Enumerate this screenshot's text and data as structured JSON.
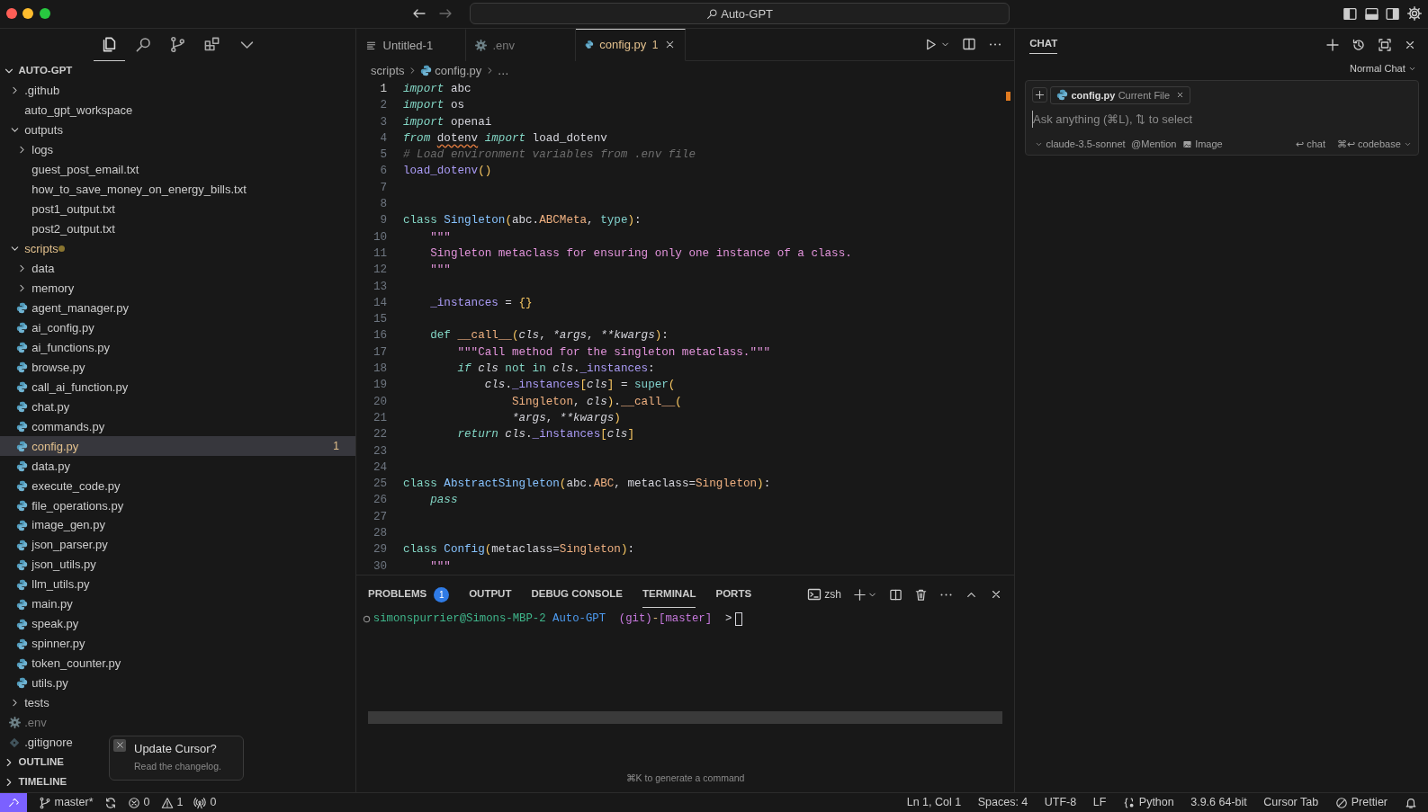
{
  "window": {
    "title": "Auto-GPT"
  },
  "activity_bar": [
    {
      "kind": "files",
      "selected": true
    },
    {
      "kind": "search",
      "selected": false
    },
    {
      "kind": "source-control",
      "selected": false
    },
    {
      "kind": "extensions",
      "selected": false
    },
    {
      "kind": "more",
      "selected": false
    }
  ],
  "explorer": {
    "title": "AUTO-GPT",
    "expanded": true,
    "items": [
      {
        "label": ".github",
        "kind": "folder",
        "expanded": false
      },
      {
        "label": "auto_gpt_workspace",
        "kind": "empty-folder"
      },
      {
        "label": "outputs",
        "kind": "folder",
        "expanded": true,
        "children": [
          {
            "label": "logs",
            "kind": "folder",
            "expanded": false
          },
          {
            "label": "guest_post_email.txt",
            "kind": "text-file"
          },
          {
            "label": "how_to_save_money_on_energy_bills.txt",
            "kind": "text-file"
          },
          {
            "label": "post1_output.txt",
            "kind": "text-file"
          },
          {
            "label": "post2_output.txt",
            "kind": "text-file"
          }
        ]
      },
      {
        "label": "scripts",
        "kind": "folder",
        "expanded": true,
        "modified": true,
        "children": [
          {
            "label": "data",
            "kind": "folder",
            "expanded": false
          },
          {
            "label": "memory",
            "kind": "folder",
            "expanded": false
          },
          {
            "label": "agent_manager.py",
            "kind": "python-file"
          },
          {
            "label": "ai_config.py",
            "kind": "python-file"
          },
          {
            "label": "ai_functions.py",
            "kind": "python-file"
          },
          {
            "label": "browse.py",
            "kind": "python-file"
          },
          {
            "label": "call_ai_function.py",
            "kind": "python-file"
          },
          {
            "label": "chat.py",
            "kind": "python-file"
          },
          {
            "label": "commands.py",
            "kind": "python-file"
          },
          {
            "label": "config.py",
            "kind": "python-file",
            "selected": true,
            "modified": true,
            "badge": "1"
          },
          {
            "label": "data.py",
            "kind": "python-file"
          },
          {
            "label": "execute_code.py",
            "kind": "python-file"
          },
          {
            "label": "file_operations.py",
            "kind": "python-file"
          },
          {
            "label": "image_gen.py",
            "kind": "python-file"
          },
          {
            "label": "json_parser.py",
            "kind": "python-file"
          },
          {
            "label": "json_utils.py",
            "kind": "python-file"
          },
          {
            "label": "llm_utils.py",
            "kind": "python-file"
          },
          {
            "label": "main.py",
            "kind": "python-file"
          },
          {
            "label": "speak.py",
            "kind": "python-file"
          },
          {
            "label": "spinner.py",
            "kind": "python-file"
          },
          {
            "label": "token_counter.py",
            "kind": "python-file"
          },
          {
            "label": "utils.py",
            "kind": "python-file"
          }
        ]
      },
      {
        "label": "tests",
        "kind": "folder",
        "expanded": false
      },
      {
        "label": ".env",
        "kind": "settings-file",
        "dimmed": true
      },
      {
        "label": ".gitignore",
        "kind": "git-file"
      }
    ]
  },
  "sections": [
    {
      "label": "OUTLINE",
      "expanded": false
    },
    {
      "label": "TIMELINE",
      "expanded": false
    }
  ],
  "toast": {
    "title": "Update Cursor?",
    "message": "Read the changelog."
  },
  "editor": {
    "tabs": [
      {
        "label": "Untitled-1",
        "kind": "untitled",
        "selected": false
      },
      {
        "label": ".env",
        "kind": "settings-file",
        "selected": false,
        "dimmed": true
      },
      {
        "label": "config.py",
        "kind": "python-file",
        "selected": true,
        "modified": true,
        "badge": "1"
      }
    ],
    "breadcrumb": [
      {
        "label": "scripts",
        "kind": "folder"
      },
      {
        "label": "config.py",
        "kind": "python-file"
      },
      {
        "label": "…",
        "kind": "symbol"
      }
    ],
    "lines": [
      {
        "n": "1",
        "current": true,
        "tokens": [
          {
            "t": "import",
            "kind": "kwi"
          },
          {
            "t": " abc",
            "kind": "p"
          }
        ]
      },
      {
        "n": "2",
        "tokens": [
          {
            "t": "import",
            "kind": "kwi"
          },
          {
            "t": " os",
            "kind": "p"
          }
        ]
      },
      {
        "n": "3",
        "tokens": [
          {
            "t": "import",
            "kind": "kwi"
          },
          {
            "t": " openai",
            "kind": "p"
          }
        ]
      },
      {
        "n": "4",
        "tokens": [
          {
            "t": "from ",
            "kind": "kwi"
          },
          {
            "t": "dotenv",
            "kind": "p",
            "squiggle": true
          },
          {
            "t": " import",
            "kind": "kwi"
          },
          {
            "t": " load_dotenv",
            "kind": "p"
          }
        ]
      },
      {
        "n": "5",
        "tokens": [
          {
            "t": "# Load environment variables from .env file",
            "kind": "com"
          }
        ]
      },
      {
        "n": "6",
        "tokens": [
          {
            "t": "load_dotenv",
            "kind": "fn"
          },
          {
            "t": "()",
            "kind": "punc"
          }
        ]
      },
      {
        "n": "7"
      },
      {
        "n": "8"
      },
      {
        "n": "9",
        "tokens": [
          {
            "t": "class",
            "kind": "kw"
          },
          {
            "t": " Singleton",
            "kind": "cls"
          },
          {
            "t": "(",
            "kind": "punc"
          },
          {
            "t": "abc.",
            "kind": "p"
          },
          {
            "t": "ABCMeta",
            "kind": "type"
          },
          {
            "t": ", ",
            "kind": "p"
          },
          {
            "t": "type",
            "kind": "bi"
          },
          {
            "t": ")",
            "kind": "punc"
          },
          {
            "t": ":",
            "kind": "p"
          }
        ]
      },
      {
        "n": "10",
        "tokens": [
          {
            "t": "    \"\"\"",
            "kind": "str"
          }
        ]
      },
      {
        "n": "11",
        "tokens": [
          {
            "t": "    Singleton metaclass for ensuring only one instance of a class.",
            "kind": "str"
          }
        ]
      },
      {
        "n": "12",
        "tokens": [
          {
            "t": "    \"\"\"",
            "kind": "str"
          }
        ]
      },
      {
        "n": "13"
      },
      {
        "n": "14",
        "tokens": [
          {
            "t": "    _instances",
            "kind": "prop"
          },
          {
            "t": " = ",
            "kind": "p"
          },
          {
            "t": "{}",
            "kind": "punc"
          }
        ]
      },
      {
        "n": "15"
      },
      {
        "n": "16",
        "tokens": [
          {
            "t": "    def",
            "kind": "kw"
          },
          {
            "t": " __call__",
            "kind": "type"
          },
          {
            "t": "(",
            "kind": "punc"
          },
          {
            "t": "cls",
            "kind": "param"
          },
          {
            "t": ", ",
            "kind": "p"
          },
          {
            "t": "*args",
            "kind": "param"
          },
          {
            "t": ", ",
            "kind": "p"
          },
          {
            "t": "**kwargs",
            "kind": "param"
          },
          {
            "t": ")",
            "kind": "punc"
          },
          {
            "t": ":",
            "kind": "p"
          }
        ]
      },
      {
        "n": "17",
        "tokens": [
          {
            "t": "        \"\"\"Call method for the singleton metaclass.\"\"\"",
            "kind": "str"
          }
        ]
      },
      {
        "n": "18",
        "tokens": [
          {
            "t": "        if",
            "kind": "kwi"
          },
          {
            "t": " cls",
            "kind": "param"
          },
          {
            "t": " not",
            "kind": "kw"
          },
          {
            "t": " in",
            "kind": "kw"
          },
          {
            "t": " cls",
            "kind": "param"
          },
          {
            "t": ".",
            "kind": "p"
          },
          {
            "t": "_instances",
            "kind": "prop"
          },
          {
            "t": ":",
            "kind": "p"
          }
        ]
      },
      {
        "n": "19",
        "tokens": [
          {
            "t": "            cls",
            "kind": "param"
          },
          {
            "t": ".",
            "kind": "p"
          },
          {
            "t": "_instances",
            "kind": "prop"
          },
          {
            "t": "[",
            "kind": "punc"
          },
          {
            "t": "cls",
            "kind": "param"
          },
          {
            "t": "]",
            "kind": "punc"
          },
          {
            "t": " = ",
            "kind": "p"
          },
          {
            "t": "super",
            "kind": "bi"
          },
          {
            "t": "(",
            "kind": "punc"
          }
        ]
      },
      {
        "n": "20",
        "tokens": [
          {
            "t": "                Singleton",
            "kind": "type"
          },
          {
            "t": ", ",
            "kind": "p"
          },
          {
            "t": "cls",
            "kind": "param"
          },
          {
            "t": ")",
            "kind": "punc"
          },
          {
            "t": ".",
            "kind": "p"
          },
          {
            "t": "__call__",
            "kind": "type"
          },
          {
            "t": "(",
            "kind": "punc"
          }
        ]
      },
      {
        "n": "21",
        "tokens": [
          {
            "t": "                *args",
            "kind": "param"
          },
          {
            "t": ", ",
            "kind": "p"
          },
          {
            "t": "**kwargs",
            "kind": "param"
          },
          {
            "t": ")",
            "kind": "punc"
          }
        ]
      },
      {
        "n": "22",
        "tokens": [
          {
            "t": "        return",
            "kind": "kwi"
          },
          {
            "t": " cls",
            "kind": "param"
          },
          {
            "t": ".",
            "kind": "p"
          },
          {
            "t": "_instances",
            "kind": "prop"
          },
          {
            "t": "[",
            "kind": "punc"
          },
          {
            "t": "cls",
            "kind": "param"
          },
          {
            "t": "]",
            "kind": "punc"
          }
        ]
      },
      {
        "n": "23"
      },
      {
        "n": "24"
      },
      {
        "n": "25",
        "tokens": [
          {
            "t": "class",
            "kind": "kw"
          },
          {
            "t": " AbstractSingleton",
            "kind": "cls"
          },
          {
            "t": "(",
            "kind": "punc"
          },
          {
            "t": "abc.",
            "kind": "p"
          },
          {
            "t": "ABC",
            "kind": "type"
          },
          {
            "t": ", metaclass=",
            "kind": "p"
          },
          {
            "t": "Singleton",
            "kind": "type"
          },
          {
            "t": ")",
            "kind": "punc"
          },
          {
            "t": ":",
            "kind": "p"
          }
        ]
      },
      {
        "n": "26",
        "tokens": [
          {
            "t": "    pass",
            "kind": "kwi"
          }
        ]
      },
      {
        "n": "27"
      },
      {
        "n": "28"
      },
      {
        "n": "29",
        "tokens": [
          {
            "t": "class",
            "kind": "kw"
          },
          {
            "t": " Config",
            "kind": "cls"
          },
          {
            "t": "(",
            "kind": "punc"
          },
          {
            "t": "metaclass=",
            "kind": "p"
          },
          {
            "t": "Singleton",
            "kind": "type"
          },
          {
            "t": ")",
            "kind": "punc"
          },
          {
            "t": ":",
            "kind": "p"
          }
        ]
      },
      {
        "n": "30",
        "tokens": [
          {
            "t": "    \"\"\"",
            "kind": "str"
          }
        ]
      }
    ]
  },
  "panel": {
    "tabs": [
      {
        "label": "PROBLEMS",
        "selected": false,
        "badge": "1"
      },
      {
        "label": "OUTPUT",
        "selected": false
      },
      {
        "label": "DEBUG CONSOLE",
        "selected": false
      },
      {
        "label": "TERMINAL",
        "selected": true
      },
      {
        "label": "PORTS",
        "selected": false
      }
    ],
    "shell": "zsh",
    "terminal_line": [
      {
        "t": "simonspurrier@Simons-MBP-2",
        "kind": "user"
      },
      {
        "t": " Auto-GPT",
        "kind": "dir"
      },
      {
        "t": "  (git)",
        "kind": "git"
      },
      {
        "t": "-",
        "kind": "sep"
      },
      {
        "t": "[master]",
        "kind": "git"
      },
      {
        "t": "  >",
        "kind": "p"
      }
    ],
    "hint": "⌘K to generate a command"
  },
  "chat": {
    "title": "CHAT",
    "mode": "Normal Chat",
    "chips": [
      {
        "label": "config.py",
        "note": "Current File"
      }
    ],
    "placeholder": "Ask anything (⌘L), ⇅ to select",
    "footer_left": [
      {
        "kind": "dropdown",
        "text": "claude-3.5-sonnet"
      },
      {
        "kind": "plain",
        "text": "@Mention"
      },
      {
        "kind": "image",
        "text": "Image"
      }
    ],
    "footer_right": [
      {
        "kind": "plain",
        "text": "↩ chat"
      },
      {
        "kind": "dropdown-after",
        "text": "⌘↩ codebase"
      }
    ]
  },
  "status_bar": {
    "left": [
      {
        "kind": "branch",
        "text": "master*"
      },
      {
        "kind": "sync"
      },
      {
        "kind": "errors",
        "text": "0"
      },
      {
        "kind": "warnings",
        "text": "1"
      },
      {
        "kind": "ports",
        "text": "0"
      }
    ],
    "right": [
      {
        "kind": "plain",
        "text": "Ln 1, Col 1"
      },
      {
        "kind": "plain",
        "text": "Spaces: 4"
      },
      {
        "kind": "plain",
        "text": "UTF-8"
      },
      {
        "kind": "plain",
        "text": "LF"
      },
      {
        "kind": "braces",
        "text": "Python"
      },
      {
        "kind": "plain",
        "text": "3.9.6 64-bit"
      },
      {
        "kind": "plain",
        "text": "Cursor Tab"
      },
      {
        "kind": "no-entry",
        "text": "Prettier"
      },
      {
        "kind": "bell"
      }
    ]
  }
}
